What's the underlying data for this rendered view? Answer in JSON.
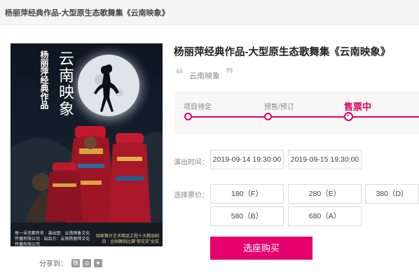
{
  "breadcrumb": {
    "title": "杨丽萍经典作品-大型原生态歌舞集《云南映象》"
  },
  "poster": {
    "author_text": "杨丽萍经典作品",
    "calligraphy_title": "云南映象",
    "bottom_left_text": "每一朵花都有名 · 演出团：云南映象文化传播有限公司 · 出品方：云南杨丽萍文化传播有限公司",
    "bottom_right_text": "国家舞台艺术精品工程十大精品剧目 · 全国舞蹈比赛“荷花奖”金奖",
    "colors": {
      "sky": "#111a26",
      "moon": "#dfe3ea",
      "costume_red": "#b5182a"
    }
  },
  "share": {
    "label": "分享到：",
    "icons": [
      "weibo-icon",
      "wechat-icon",
      "qzone-icon"
    ]
  },
  "show": {
    "title": "杨丽萍经典作品-大型原生态歌舞集《云南映象》",
    "tagline": "云南映象",
    "quote_open": "❝",
    "quote_close": "❞"
  },
  "progress": {
    "steps": [
      {
        "label": "项目待定",
        "active": false
      },
      {
        "label": "预售/预订",
        "active": false
      },
      {
        "label": "售票中",
        "active": true
      }
    ]
  },
  "showtimes": {
    "label": "演出时间：",
    "options": [
      "2019-09-14 19:30:00",
      "2019-09-15 19:30:00"
    ]
  },
  "prices": {
    "label": "选择票价：",
    "options": [
      "180（F）",
      "280（E）",
      "380（D）",
      "580（B）",
      "680（A）"
    ]
  },
  "buy_button": {
    "label": "选座购买"
  },
  "theme": {
    "accent": "#e5005a",
    "button": "#e5006e"
  }
}
